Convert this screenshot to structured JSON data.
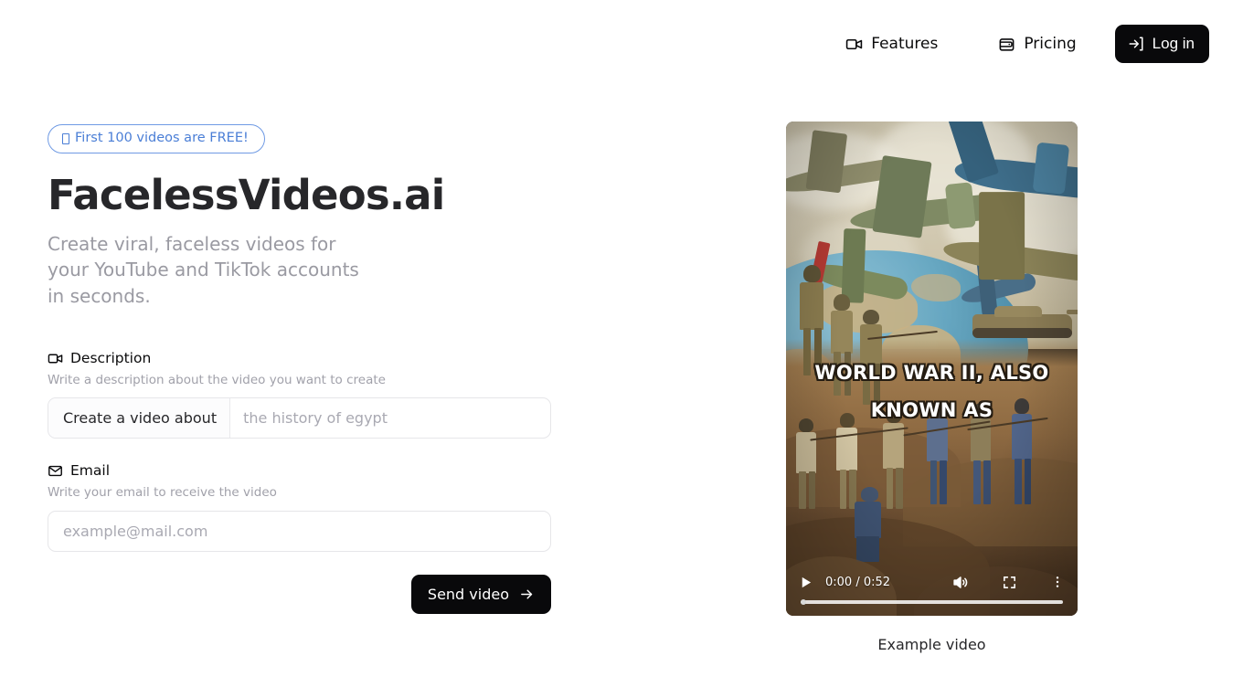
{
  "header": {
    "nav": [
      {
        "label": "Features",
        "icon": "video-camera-icon"
      },
      {
        "label": "Pricing",
        "icon": "wallet-icon"
      }
    ],
    "login_label": "Log in",
    "login_icon": "log-in-icon"
  },
  "hero": {
    "badge_text": "First 100 videos are FREE!",
    "badge_color": "#4a7ed6",
    "title": "FacelessVideos.ai",
    "subtitle": "Create viral, faceless videos for your YouTube and TikTok accounts in seconds."
  },
  "form": {
    "description": {
      "label": "Description",
      "icon": "video-camera-icon",
      "help": "Write a description about the video you want to create",
      "prefix": "Create a video about",
      "placeholder": "the history of egypt",
      "value": ""
    },
    "email": {
      "label": "Email",
      "icon": "mail-icon",
      "help": "Write your email to receive the video",
      "placeholder": "example@mail.com",
      "value": ""
    },
    "submit_label": "Send video"
  },
  "video": {
    "caption": "Example video",
    "subtitle_lines": [
      "WORLD WAR II, ALSO",
      "KNOWN AS"
    ],
    "controls": {
      "play_icon": "play-icon",
      "time": "0:00 / 0:52",
      "current_time": "0:00",
      "duration": "0:52",
      "mute_icon": "volume-icon",
      "fullscreen_icon": "fullscreen-icon",
      "more_icon": "more-vertical-icon",
      "progress_percent": 0
    }
  },
  "theme": {
    "accent_dark": "#09090b",
    "badge_blue": "#4a7ed6",
    "muted_text": "#a1a1aa",
    "border": "#e6e6e9"
  }
}
